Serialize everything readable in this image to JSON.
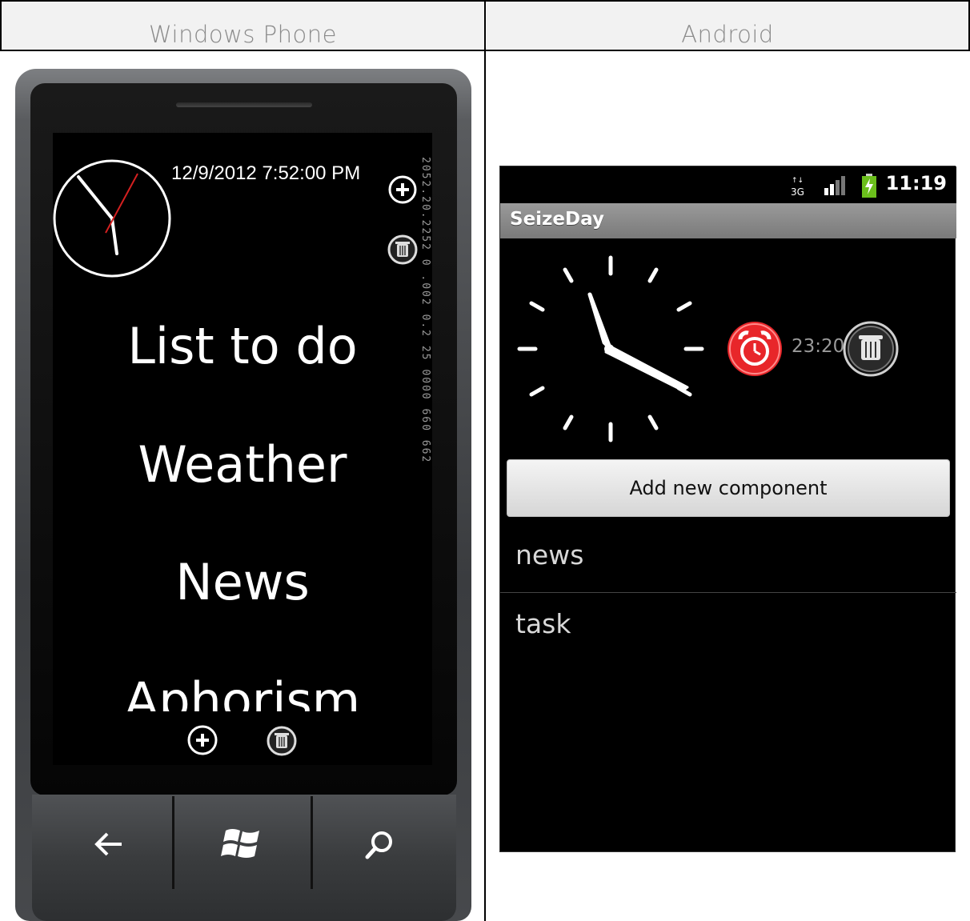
{
  "headers": {
    "windows_phone": "Windows Phone",
    "android": "Android"
  },
  "windows_phone": {
    "datetime": "12/9/2012 7:52:00 PM",
    "items": [
      "List to do",
      "Weather",
      "News",
      "Aphorism"
    ],
    "vertical_text": "2052.20.2252 0 .002 0.2 25 0000 660 662",
    "icons": [
      "add-icon",
      "delete-icon",
      "back-icon",
      "windows-logo-icon",
      "search-icon"
    ]
  },
  "android": {
    "status_time": "11:19",
    "network": "3G",
    "app_title": "SeizeDay",
    "alarm_time": "23:20",
    "add_button": "Add new component",
    "list": [
      "news",
      "task"
    ],
    "alarm_color": "#e8262a"
  }
}
